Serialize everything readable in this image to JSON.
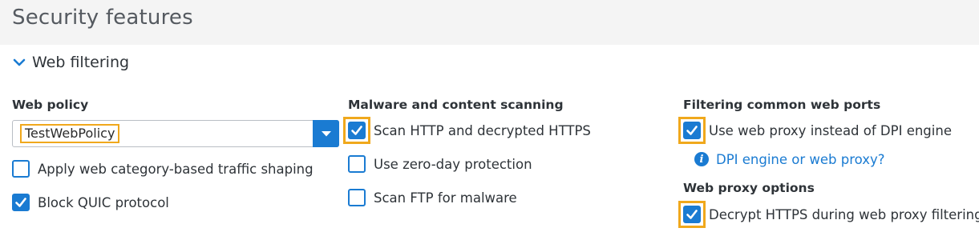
{
  "page": {
    "title": "Security features"
  },
  "section": {
    "label": "Web filtering"
  },
  "web_policy": {
    "heading": "Web policy",
    "select_value": "TestWebPolicy",
    "options": [
      {
        "label": "Apply web category-based traffic shaping",
        "checked": false
      },
      {
        "label": "Block QUIC protocol",
        "checked": true
      }
    ]
  },
  "malware": {
    "heading": "Malware and content scanning",
    "options": [
      {
        "label": "Scan HTTP and decrypted HTTPS",
        "checked": true,
        "highlighted": true
      },
      {
        "label": "Use zero-day protection",
        "checked": false
      },
      {
        "label": "Scan FTP for malware",
        "checked": false
      }
    ]
  },
  "web_ports": {
    "heading": "Filtering common web ports",
    "options": [
      {
        "label": "Use web proxy instead of DPI engine",
        "checked": true,
        "highlighted": true
      }
    ],
    "info_link": "DPI engine or web proxy?",
    "info_icon": "info-icon"
  },
  "proxy": {
    "heading": "Web proxy options",
    "options": [
      {
        "label": "Decrypt HTTPS during web proxy filtering",
        "checked": true,
        "highlighted": true
      }
    ]
  },
  "colors": {
    "accent": "#1a7bd2",
    "highlight": "#f0a81c",
    "header_bg": "#f4f4f4"
  }
}
